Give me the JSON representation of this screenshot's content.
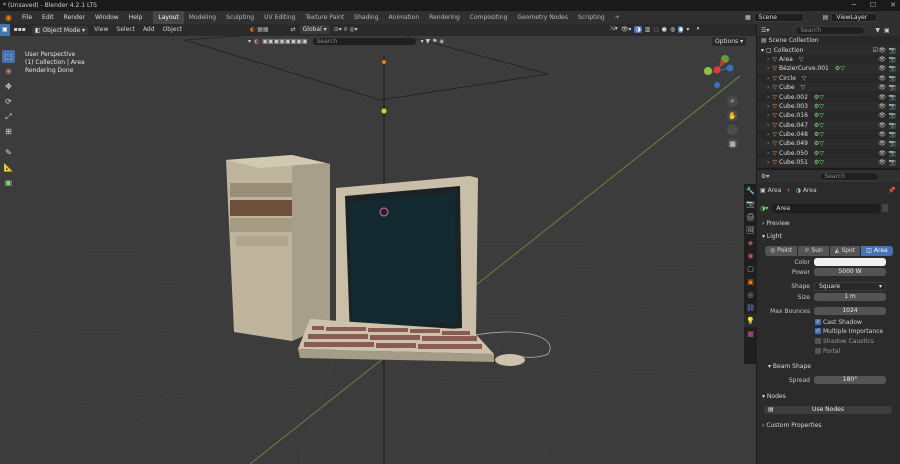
{
  "app": {
    "title": "* (Unsaved) - Blender 4.2.1 LTS"
  },
  "menu": [
    "File",
    "Edit",
    "Render",
    "Window",
    "Help"
  ],
  "workspaces": [
    "Layout",
    "Modeling",
    "Sculpting",
    "UV Editing",
    "Texture Paint",
    "Shading",
    "Animation",
    "Rendering",
    "Compositing",
    "Geometry Nodes",
    "Scripting"
  ],
  "active_workspace": "Layout",
  "scene": {
    "name": "Scene",
    "view_layer": "ViewLayer"
  },
  "viewport": {
    "mode": "Object Mode",
    "menus": [
      "View",
      "Select",
      "Add",
      "Object"
    ],
    "transform_orientation": "Global",
    "options_label": "Options",
    "search_placeholder": "Search",
    "overlay_line1": "User Perspective",
    "overlay_line2": "(1) Collection | Area",
    "overlay_line3": "Rendering Done"
  },
  "outliner": {
    "search_placeholder": "Search",
    "root": "Scene Collection",
    "collection": "Collection",
    "items": [
      "Area",
      "BézierCurve.001",
      "Circle",
      "Cube",
      "Cube.002",
      "Cube.003",
      "Cube.016",
      "Cube.047",
      "Cube.048",
      "Cube.049",
      "Cube.050",
      "Cube.051"
    ]
  },
  "properties": {
    "search_placeholder": "Search",
    "breadcrumb_object": "Area",
    "breadcrumb_data": "Area",
    "datablock_name": "Area",
    "preview_label": "Preview",
    "light_label": "Light",
    "light_types": [
      "Point",
      "Sun",
      "Spot",
      "Area"
    ],
    "active_light_type": "Area",
    "color_label": "Color",
    "power_label": "Power",
    "power_value": "5000 W",
    "shape_label": "Shape",
    "shape_value": "Square",
    "size_label": "Size",
    "size_value": "1 m",
    "max_bounces_label": "Max Bounces",
    "max_bounces_value": "1024",
    "cast_shadow": "Cast Shadow",
    "multiple_importance": "Multiple Importance",
    "shadow_caustics": "Shadow Caustics",
    "portal": "Portal",
    "beam_shape_label": "Beam Shape",
    "spread_label": "Spread",
    "spread_value": "180°",
    "nodes_label": "Nodes",
    "use_nodes_label": "Use Nodes",
    "custom_props_label": "Custom Properties"
  },
  "colors": {
    "accent": "#4772b3",
    "light_green": "#7fe07f"
  }
}
